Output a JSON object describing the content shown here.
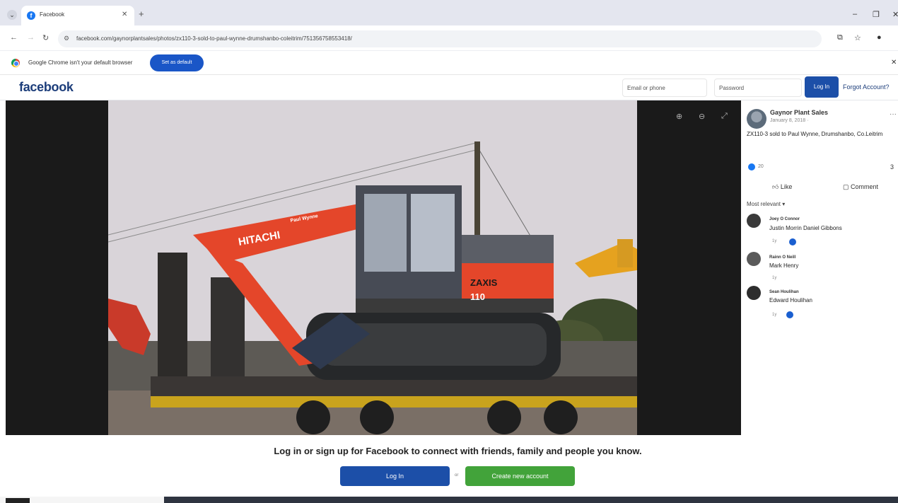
{
  "browser": {
    "tab_title": "Facebook",
    "url": "facebook.com/gaynorplantsales/photos/zx110-3-sold-to-paul-wynne-drumshanbo-coleitrim/751356758553418/",
    "infobar_text": "Google Chrome isn't your default browser",
    "set_default_label": "Set as default"
  },
  "header": {
    "logo": "facebook",
    "email_placeholder": "Email or phone",
    "password_placeholder": "Password",
    "login_label": "Log In",
    "forgot_label": "Forgot Account?"
  },
  "post": {
    "page_name": "Gaynor Plant Sales",
    "date": "January 8, 2018 ·",
    "caption": "ZX110-3 sold to Paul Wynne, Drumshanbo, Co.Leitrim",
    "like_count": "20",
    "share_count": "3",
    "like_label": "Like",
    "comment_label": "Comment",
    "sort_label": "Most relevant ▾",
    "comments": [
      {
        "author": "Joey O Connor",
        "text": "Justin Morrin Daniel Gibbons",
        "meta": "1y"
      },
      {
        "author": "Rainn O Neill",
        "text": "Mark Henry",
        "meta": "1y"
      },
      {
        "author": "Sean Houlihan",
        "text": "Edward Houlihan",
        "meta": "1y"
      }
    ]
  },
  "photo": {
    "text_hitachi": "HITACHI",
    "text_paul_wynne": "Paul Wynne",
    "text_zaxis": "ZAXIS",
    "text_110": "110"
  },
  "cta": {
    "text": "Log in or sign up for Facebook to connect with friends, family and people you know.",
    "login_label": "Log In",
    "or_label": "or",
    "create_label": "Create new account"
  },
  "colors": {
    "fb_blue": "#1c4fa8",
    "fb_green": "#42a33a",
    "excavator_orange": "#e4462a"
  }
}
